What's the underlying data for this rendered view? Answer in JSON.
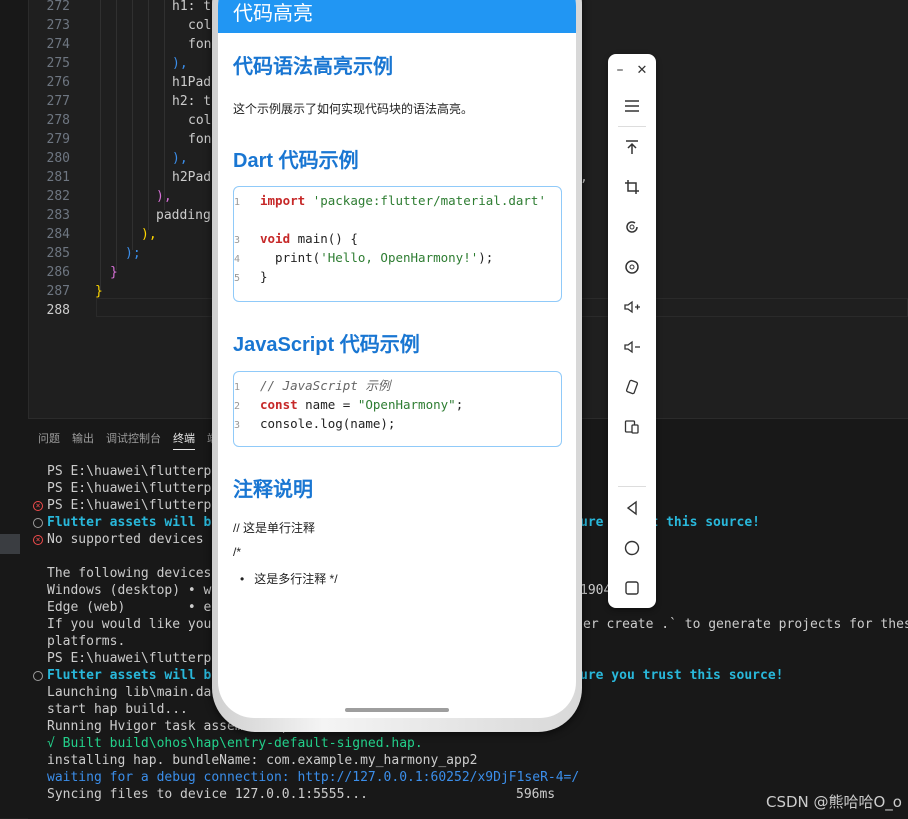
{
  "editor": {
    "line_numbers": [
      "272",
      "273",
      "274",
      "275",
      "276",
      "277",
      "278",
      "279",
      "280",
      "281",
      "282",
      "283",
      "284",
      "285",
      "286",
      "287",
      "288"
    ],
    "lines": [
      {
        "text": "h1: t",
        "color": "#cccccc"
      },
      {
        "text": "col",
        "color": "#cccccc"
      },
      {
        "text": "fon",
        "color": "#cccccc"
      },
      {
        "text": "),",
        "color": "#3b8eea"
      },
      {
        "text": "h1Pad",
        "color": "#cccccc"
      },
      {
        "text": "h2: t",
        "color": "#cccccc"
      },
      {
        "text": "col",
        "color": "#cccccc"
      },
      {
        "text": "fon",
        "color": "#cccccc"
      },
      {
        "text": "),",
        "color": "#3b8eea"
      },
      {
        "text": "h2Pad",
        "color": "#cccccc"
      },
      {
        "text": "),",
        "color": "#d670d6"
      },
      {
        "text": "padding",
        "color": "#cccccc"
      },
      {
        "text": "),",
        "color": "#ffd700"
      },
      {
        "text": ");",
        "color": "#3b8eea"
      },
      {
        "text": "}",
        "color": "#d670d6"
      },
      {
        "text": "}",
        "color": "#ffd700"
      },
      {
        "text": "",
        "color": "#cccccc"
      }
    ],
    "right_fragments": [
      ",",
      "、"
    ]
  },
  "panel": {
    "tabs": [
      "问题",
      "输出",
      "调试控制台",
      "终端",
      "端"
    ],
    "active_tab": "终端",
    "terminal": [
      {
        "text": "PS E:\\huawei\\flutterproj",
        "style": "plain",
        "marker": ""
      },
      {
        "text": "PS E:\\huawei\\flutterproj",
        "style": "plain",
        "marker": ""
      },
      {
        "text": "PS E:\\huawei\\flutterproj",
        "style": "plain",
        "marker": "err"
      },
      {
        "text": "Flutter assets will be c",
        "style": "cyan",
        "marker": "info",
        "tail": "ure  trust this source!"
      },
      {
        "text": "No supported devices con",
        "style": "plain",
        "marker": "err"
      },
      {
        "text": "",
        "style": "plain",
        "marker": ""
      },
      {
        "text": "The following devices we",
        "style": "plain",
        "marker": ""
      },
      {
        "text": "Windows (desktop) • wind",
        "style": "plain",
        "marker": "",
        "tail": "1904"
      },
      {
        "text": "Edge (web)        • edge",
        "style": "plain",
        "marker": ""
      },
      {
        "text": "If you would like your a",
        "style": "plain",
        "marker": "",
        "tail": "er create .` to generate projects for these"
      },
      {
        "text": "platforms.",
        "style": "plain",
        "marker": ""
      },
      {
        "text": "PS E:\\huawei\\flutterproj",
        "style": "plain",
        "marker": ""
      },
      {
        "text": "Flutter assets will be c",
        "style": "cyan",
        "marker": "info",
        "tail": "ure you trust this source!"
      },
      {
        "text": "Launching lib\\main.dart",
        "style": "plain",
        "marker": ""
      },
      {
        "text": "start hap build...",
        "style": "plain",
        "marker": ""
      },
      {
        "text": "Running Hvigor task assemblehap...",
        "style": "plain",
        "marker": ""
      },
      {
        "text": "√ Built build\\ohos\\hap\\entry-default-signed.hap.",
        "style": "green",
        "marker": ""
      },
      {
        "text": "installing hap. bundleName: com.example.my_harmony_app2",
        "style": "plain",
        "marker": ""
      },
      {
        "text": "waiting for a debug connection: http://127.0.0.1:60252/x9DjF1seR-4=/",
        "style": "blue",
        "marker": ""
      },
      {
        "text": "Syncing files to device 127.0.0.1:5555...",
        "style": "plain",
        "marker": "",
        "tail": "596ms"
      }
    ]
  },
  "phone": {
    "appbar_title": "代码高亮",
    "heading1": "代码语法高亮示例",
    "intro": "这个示例展示了如何实现代码块的语法高亮。",
    "heading_dart": "Dart 代码示例",
    "dart_code": [
      {
        "num": "1",
        "parts": [
          {
            "t": "import ",
            "c": "k"
          },
          {
            "t": "'package:flutter/material.dart'",
            "c": "s"
          }
        ]
      },
      {
        "num": "",
        "parts": []
      },
      {
        "num": "3",
        "parts": [
          {
            "t": "void ",
            "c": "k"
          },
          {
            "t": "main() {",
            "c": "t"
          }
        ]
      },
      {
        "num": "4",
        "parts": [
          {
            "t": "  print(",
            "c": "t"
          },
          {
            "t": "'Hello, OpenHarmony!'",
            "c": "s"
          },
          {
            "t": ");",
            "c": "t"
          }
        ]
      },
      {
        "num": "5",
        "parts": [
          {
            "t": "}",
            "c": "t"
          }
        ]
      }
    ],
    "heading_js": "JavaScript 代码示例",
    "js_code": [
      {
        "num": "1",
        "parts": [
          {
            "t": "// JavaScript 示例",
            "c": "cm"
          }
        ]
      },
      {
        "num": "2",
        "parts": [
          {
            "t": "const ",
            "c": "k"
          },
          {
            "t": "name = ",
            "c": "t"
          },
          {
            "t": "\"OpenHarmony\"",
            "c": "s"
          },
          {
            "t": ";",
            "c": "t"
          }
        ]
      },
      {
        "num": "3",
        "parts": [
          {
            "t": "console.log(name);",
            "c": "t"
          }
        ]
      }
    ],
    "heading_notes": "注释说明",
    "note_single": "// 这是单行注释",
    "note_open": "/*",
    "note_bullet": "这是多行注释 */"
  },
  "toolbar": {
    "minimize": "–",
    "close": "✕",
    "icons": [
      "menu-icon",
      "pin-top-icon",
      "crop-icon",
      "rotate-icon",
      "screenshot-icon",
      "volume-up-icon",
      "volume-down-icon",
      "rotate-device-icon",
      "multi-device-icon",
      "back-icon",
      "home-icon",
      "recent-apps-icon"
    ]
  },
  "watermark": "CSDN @熊哈哈O_o"
}
